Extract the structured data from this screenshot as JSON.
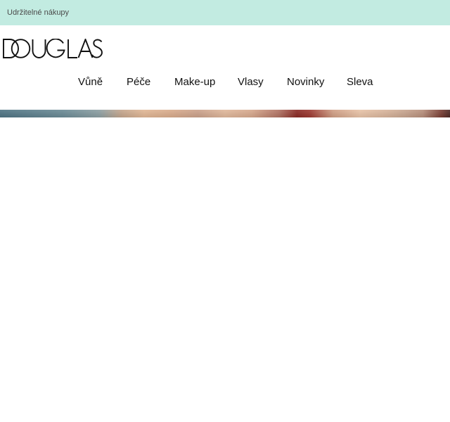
{
  "topbar": {
    "link_label": "Udržitelné nákupy",
    "background_color": "#c2ebe1"
  },
  "header": {
    "logo_text": "DOUGLAS"
  },
  "nav": {
    "items": [
      {
        "label": "Vůně"
      },
      {
        "label": "Péče"
      },
      {
        "label": "Make-up"
      },
      {
        "label": "Vlasy"
      },
      {
        "label": "Novinky"
      },
      {
        "label": "Sleva"
      }
    ]
  }
}
